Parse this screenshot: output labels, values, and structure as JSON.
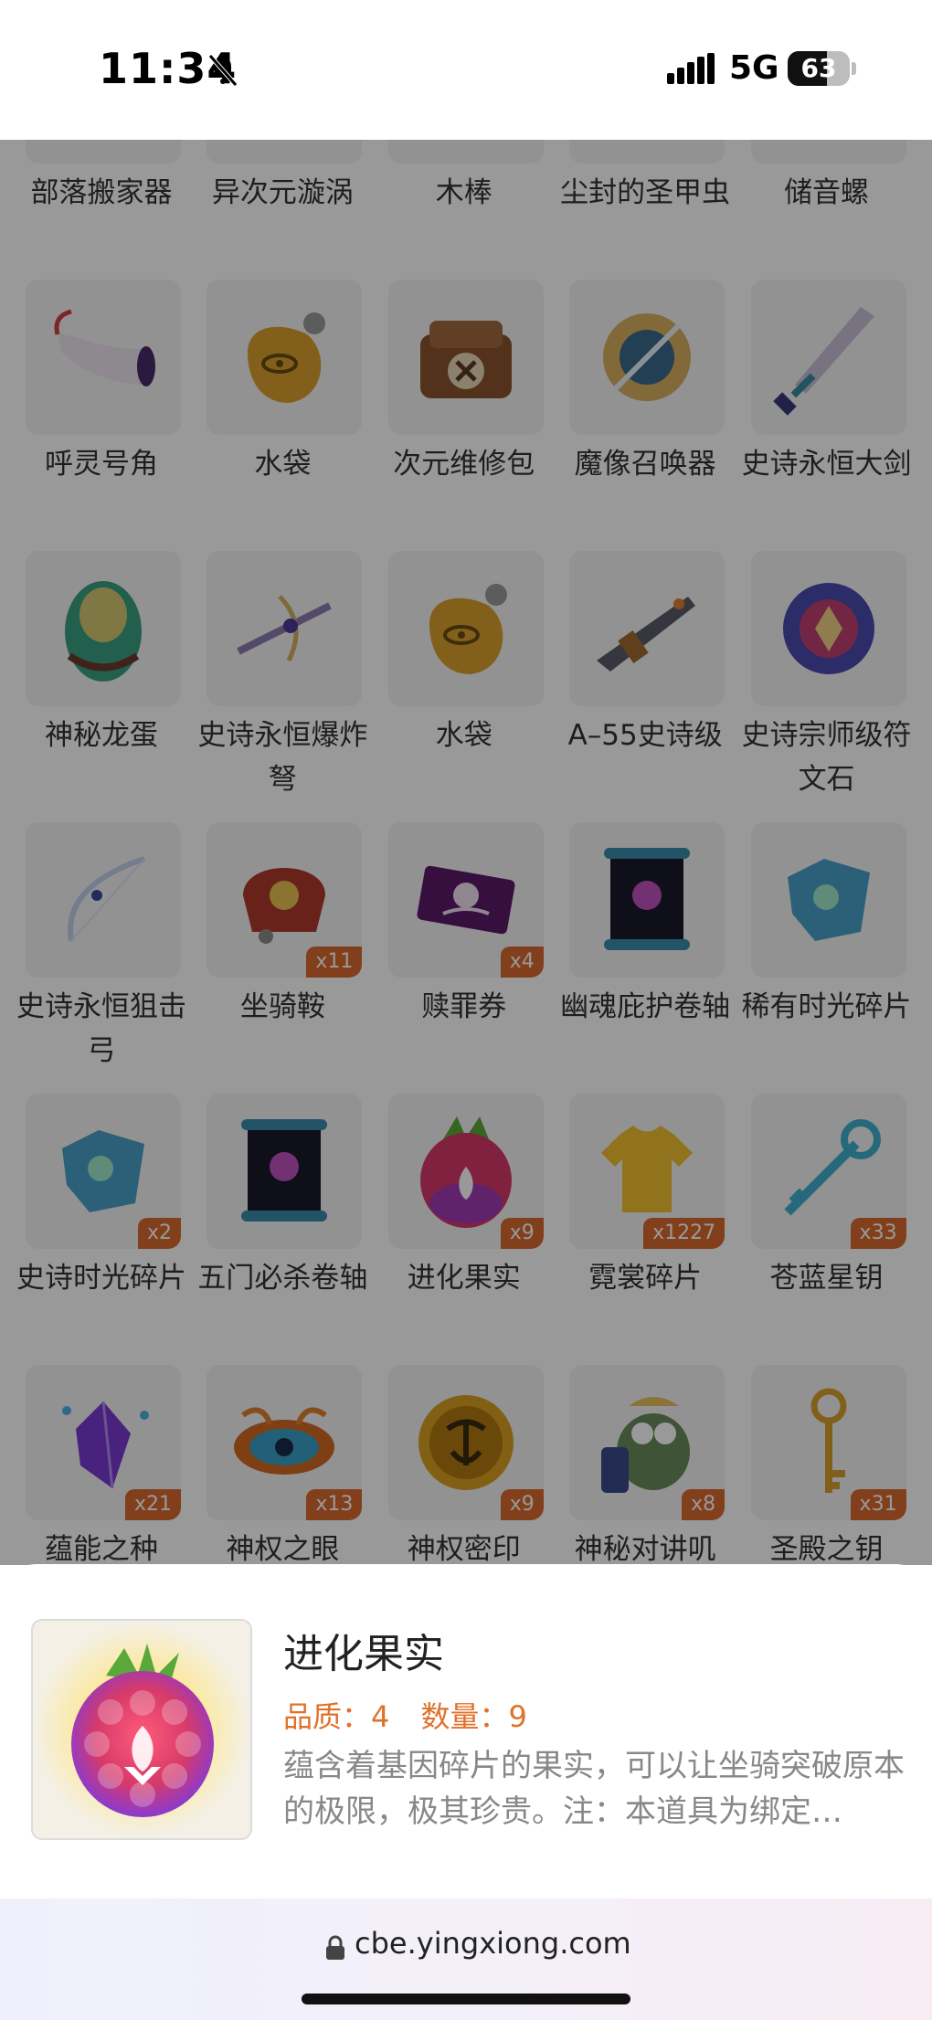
{
  "status_bar": {
    "time": "11:34",
    "network": "5G",
    "battery": "63",
    "battery_level": 0.63
  },
  "items": [
    {
      "name": "部落搬家器",
      "qty": "",
      "icon": "relocator-icon"
    },
    {
      "name": "异次元漩涡",
      "qty": "",
      "icon": "vortex-icon"
    },
    {
      "name": "木棒",
      "qty": "",
      "icon": "stick-icon"
    },
    {
      "name": "尘封的圣甲虫",
      "qty": "",
      "icon": "scarab-icon"
    },
    {
      "name": "储音螺",
      "qty": "",
      "icon": "conch-icon"
    },
    {
      "name": "呼灵号角",
      "qty": "",
      "icon": "horn-icon"
    },
    {
      "name": "水袋",
      "qty": "",
      "icon": "waterskin-icon"
    },
    {
      "name": "次元维修包",
      "qty": "",
      "icon": "repair-bag-icon"
    },
    {
      "name": "魔像召唤器",
      "qty": "",
      "icon": "golem-summoner-icon"
    },
    {
      "name": "史诗永恒大剑",
      "qty": "",
      "icon": "greatsword-icon"
    },
    {
      "name": "神秘龙蛋",
      "qty": "",
      "icon": "dragon-egg-icon"
    },
    {
      "name": "史诗永恒爆炸弩",
      "qty": "",
      "icon": "crossbow-icon"
    },
    {
      "name": "水袋",
      "qty": "",
      "icon": "waterskin-icon"
    },
    {
      "name": "A–55史诗级",
      "qty": "",
      "icon": "rifle-icon"
    },
    {
      "name": "史诗宗师级符文石",
      "qty": "",
      "icon": "runestone-icon"
    },
    {
      "name": "史诗永恒狙击弓",
      "qty": "",
      "icon": "bow-icon"
    },
    {
      "name": "坐骑鞍",
      "qty": "x11",
      "icon": "saddle-icon"
    },
    {
      "name": "赎罪券",
      "qty": "x4",
      "icon": "ticket-icon"
    },
    {
      "name": "幽魂庇护卷轴",
      "qty": "",
      "icon": "scroll-icon"
    },
    {
      "name": "稀有时光碎片",
      "qty": "",
      "icon": "time-shard-icon"
    },
    {
      "name": "史诗时光碎片",
      "qty": "x2",
      "icon": "time-shard-icon"
    },
    {
      "name": "五门必杀卷轴",
      "qty": "",
      "icon": "scroll-icon"
    },
    {
      "name": "进化果实",
      "qty": "x9",
      "icon": "evolution-fruit-icon"
    },
    {
      "name": "霓裳碎片",
      "qty": "x1227",
      "icon": "shirt-shard-icon"
    },
    {
      "name": "苍蓝星钥",
      "qty": "x33",
      "icon": "star-key-icon"
    },
    {
      "name": "蕴能之种",
      "qty": "x21",
      "icon": "crystal-seed-icon"
    },
    {
      "name": "神权之眼",
      "qty": "x13",
      "icon": "divine-eye-icon"
    },
    {
      "name": "神权密印",
      "qty": "x9",
      "icon": "seal-coin-icon"
    },
    {
      "name": "神秘对讲叽",
      "qty": "x8",
      "icon": "walkie-bird-icon"
    },
    {
      "name": "圣殿之钥",
      "qty": "x31",
      "icon": "temple-key-icon"
    }
  ],
  "detail": {
    "title": "进化果实",
    "quality": "品质：4",
    "quantity": "数量：9",
    "description": "蕴含着基因碎片的果实，可以让坐骑突破原本的极限，极其珍贵。注：本道具为绑定…",
    "icon": "evolution-fruit-icon"
  },
  "browser": {
    "url": "cbe.yingxiong.com"
  },
  "colors": {
    "accent": "#e0712a",
    "badge": "#d9692f",
    "overlay": "rgba(0,0,0,0.40)"
  }
}
